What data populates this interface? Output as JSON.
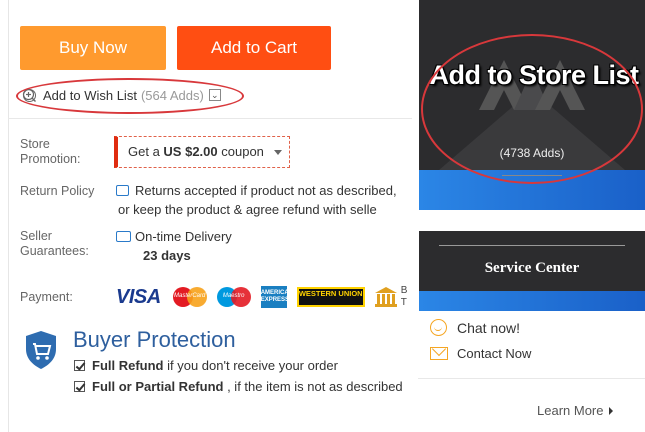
{
  "actions": {
    "buy_now": "Buy Now",
    "add_to_cart": "Add to Cart",
    "wish_list_label": "Add to Wish List",
    "wish_list_count": "(564 Adds)",
    "wish_dropdown": "⌄"
  },
  "store_promotion": {
    "label": "Store Promotion:",
    "coupon_prefix": "Get a",
    "coupon_amount": "US $2.00",
    "coupon_suffix": "coupon"
  },
  "return_policy": {
    "label": "Return Policy",
    "line1": "Returns accepted if product not as described,",
    "line2": "or keep the product & agree refund with selle"
  },
  "seller_guarantees": {
    "label": "Seller Guarantees:",
    "delivery": "On-time Delivery",
    "days": "23 days"
  },
  "payment": {
    "label": "Payment:",
    "visa": "VISA",
    "mastercard": "MasterCard",
    "maestro": "Maestro",
    "amex": "AMERICAN EXPRESS",
    "western_union": "WESTERN UNION",
    "bank_text": "B T"
  },
  "buyer_protection": {
    "title": "Buyer Protection",
    "line1_bold": "Full Refund",
    "line1_rest": " if you don't receive your order",
    "line2_bold": "Full or Partial Refund",
    "line2_rest": " , if the item is not as described",
    "learn_more": "Learn More"
  },
  "store_panel": {
    "title": "Add to Store List",
    "adds": "(4738 Adds)"
  },
  "service_panel": {
    "title": "Service Center",
    "chat": "Chat now!",
    "contact": "Contact Now"
  },
  "colors": {
    "buy_now": "#ff9a2e",
    "add_to_cart": "#ff4e12",
    "highlight_ellipse": "#d8383b",
    "brand_blue": "#2e5f9e"
  }
}
